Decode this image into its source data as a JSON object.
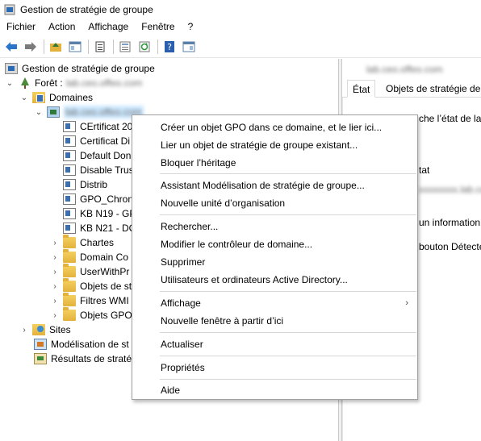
{
  "window": {
    "title": "Gestion de stratégie de groupe"
  },
  "menu": [
    "Fichier",
    "Action",
    "Affichage",
    "Fenêtre",
    "?"
  ],
  "toolbar": {
    "buttons": [
      "back-arrow-icon",
      "forward-arrow-icon",
      "up-folder-icon",
      "show-hide-tree-icon",
      "clipboard-icon",
      "properties-icon",
      "refresh-icon",
      "help-icon",
      "console-icon"
    ]
  },
  "tree": {
    "root": "Gestion de stratégie de groupe",
    "forest_label": "Forêt :",
    "forest_name": "lab.ceo.offeo.com",
    "domains": "Domaines",
    "domain_name": "lab.ceo.offeo.com",
    "children": [
      "CErtificat 20",
      "Certificat Di",
      "Default Don",
      "Disable Trus",
      "Distrib",
      "GPO_Chron",
      "KB N19 - GP",
      "KB N21 - DC",
      "Chartes",
      "Domain Co",
      "UserWithPr",
      "Objets de st",
      "Filtres WMI",
      "Objets GPO"
    ],
    "sites": "Sites",
    "modeling": "Modélisation de st",
    "results": "Résultats de stratég"
  },
  "right": {
    "title": "lab.ceo.offeo.com",
    "tabs": [
      "État",
      "Objets de stratégie de g"
    ],
    "lines": [
      "che l’état de la ré",
      "tat",
      "un information de",
      "bouton Détecter"
    ],
    "blur_line": "xxxxxxxx.lab.ceo"
  },
  "context_menu": {
    "items": [
      "Créer un objet GPO dans ce domaine, et le lier ici...",
      "Lier un objet de stratégie de groupe existant...",
      "Bloquer l’héritage",
      "Assistant Modélisation de stratégie de groupe...",
      "Nouvelle unité d’organisation",
      "Rechercher...",
      "Modifier le contrôleur de domaine...",
      "Supprimer",
      "Utilisateurs et ordinateurs Active Directory...",
      "Affichage",
      "Nouvelle fenêtre à partir d’ici",
      "Actualiser",
      "Propriétés",
      "Aide"
    ],
    "submenu_arrow": "›"
  }
}
